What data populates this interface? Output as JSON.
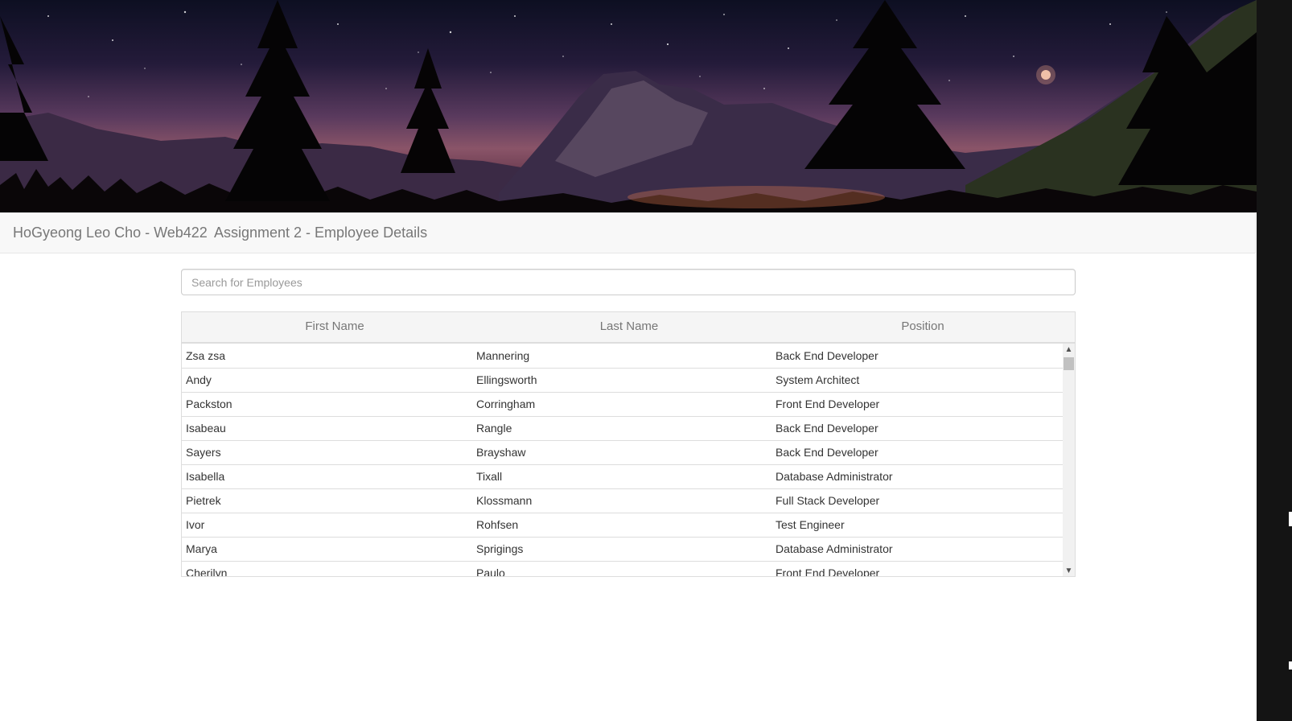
{
  "navbar": {
    "brand": "HoGyeong Leo Cho - Web422",
    "subtitle": "Assignment 2 - Employee Details"
  },
  "search": {
    "placeholder": "Search for Employees",
    "value": ""
  },
  "table": {
    "headers": [
      "First Name",
      "Last Name",
      "Position"
    ],
    "rows": [
      [
        "Zsa zsa",
        "Mannering",
        "Back End Developer"
      ],
      [
        "Andy",
        "Ellingsworth",
        "System Architect"
      ],
      [
        "Packston",
        "Corringham",
        "Front End Developer"
      ],
      [
        "Isabeau",
        "Rangle",
        "Back End Developer"
      ],
      [
        "Sayers",
        "Brayshaw",
        "Back End Developer"
      ],
      [
        "Isabella",
        "Tixall",
        "Database Administrator"
      ],
      [
        "Pietrek",
        "Klossmann",
        "Full Stack Developer"
      ],
      [
        "Ivor",
        "Rohfsen",
        "Test Engineer"
      ],
      [
        "Marya",
        "Sprigings",
        "Database Administrator"
      ],
      [
        "Cherilyn",
        "Paulo",
        "Front End Developer"
      ]
    ]
  },
  "scrollbar": {
    "up_icon": "▲",
    "down_icon": "▼"
  }
}
